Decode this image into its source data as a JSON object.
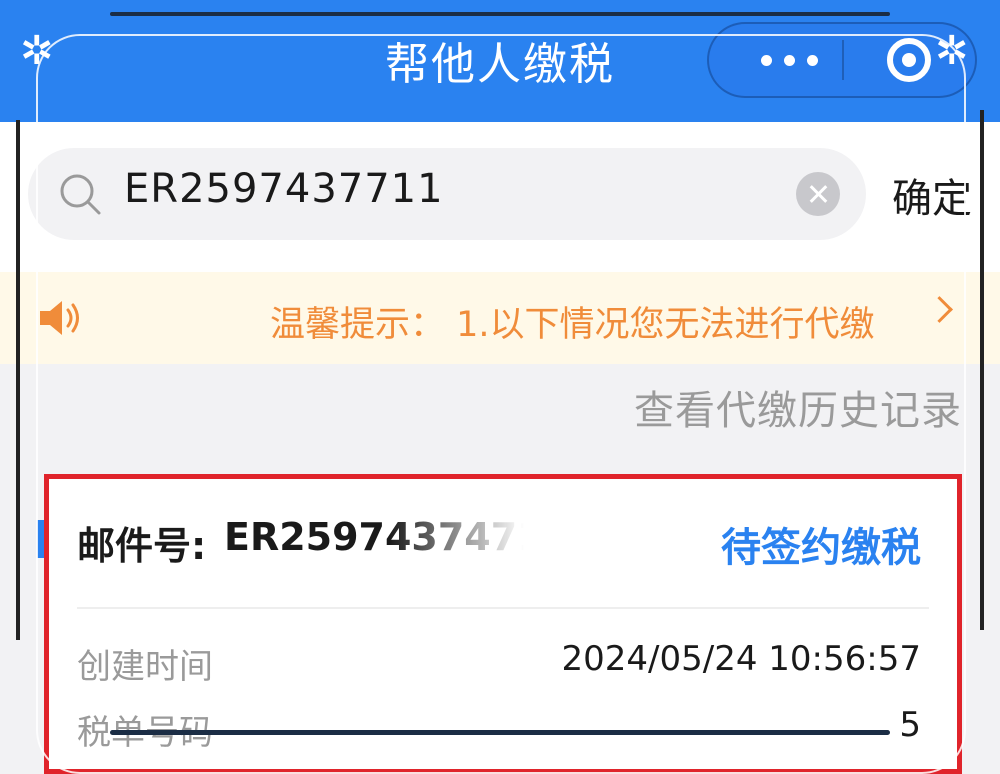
{
  "header": {
    "title": "帮他人缴税"
  },
  "search": {
    "value": "ER2597437711",
    "confirm_label": "确定"
  },
  "notice": {
    "text": "温馨提示： 1.以下情况您无法进行代缴"
  },
  "history_link": "查看代缴历史记录",
  "card": {
    "mail_label": "邮件号:",
    "mail_number": "ER2597437471",
    "status": "待签约缴税",
    "rows": [
      {
        "label": "创建时间",
        "value": "2024/05/24 10:56:57"
      },
      {
        "label": "税单号码",
        "value": "5"
      }
    ]
  },
  "colors": {
    "brand": "#2a82f0",
    "notice_text": "#f08c3a",
    "highlight_border": "#e0242b"
  }
}
